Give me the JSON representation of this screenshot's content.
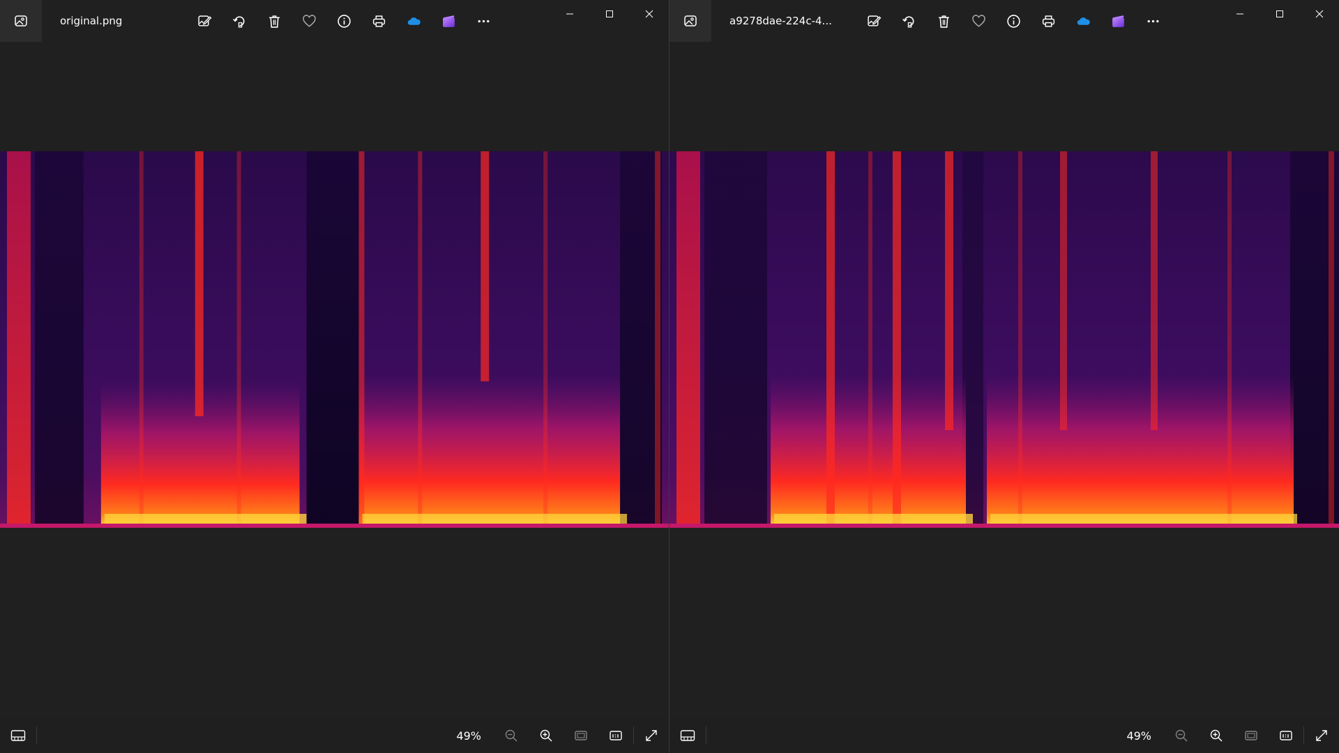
{
  "colors": {
    "background": "#202020",
    "titlebar_icon_bg": "#2c2c2c",
    "onedrive_blue": "#1f8fe6",
    "clipchamp_purple": "#8a4fff",
    "spectro_bg": "#0b0420",
    "spectro_mid": "#5a0f6e",
    "spectro_hot": "#ff1f1f",
    "spectro_peak": "#ffd23a"
  },
  "windows": [
    {
      "filename": "original.png",
      "toolbar": [
        "edit-image-icon",
        "rotate-icon",
        "delete-icon",
        "favorite-heart-icon",
        "info-icon",
        "print-icon",
        "onedrive-cloud-icon",
        "clipchamp-icon",
        "more-options-icon"
      ],
      "zoom_level": "49%"
    },
    {
      "filename": "a9278dae-224c-4...",
      "toolbar": [
        "edit-image-icon",
        "rotate-icon",
        "delete-icon",
        "favorite-heart-icon",
        "info-icon",
        "print-icon",
        "onedrive-cloud-icon",
        "clipchamp-icon",
        "more-options-icon"
      ],
      "zoom_level": "49%"
    }
  ]
}
